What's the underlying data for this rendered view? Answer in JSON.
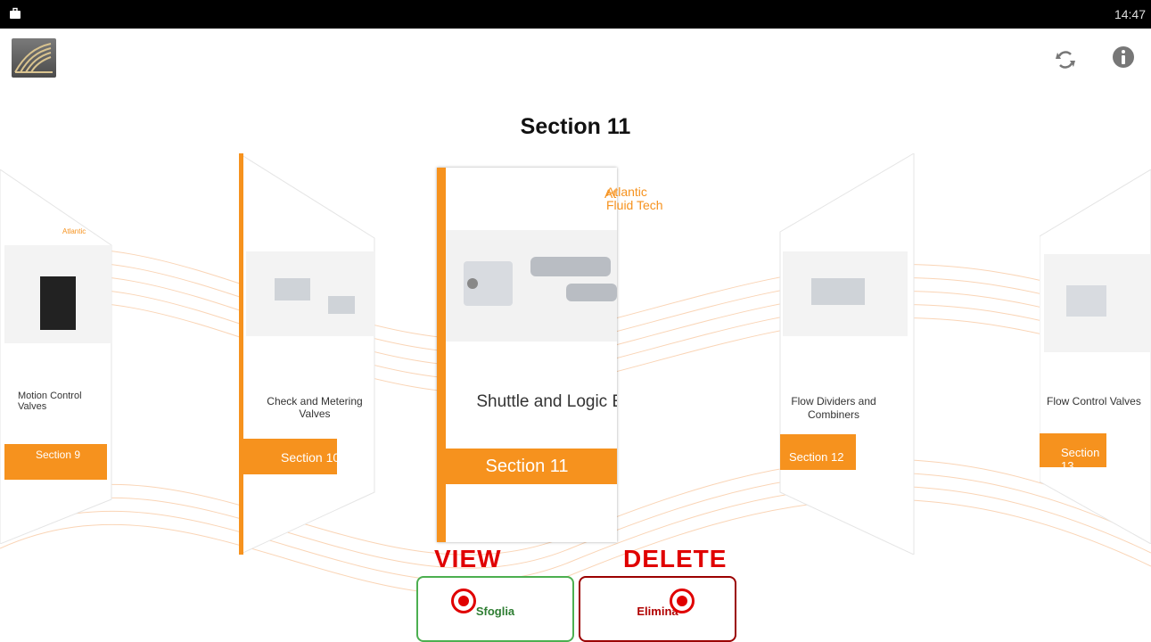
{
  "statusbar": {
    "time": "14:47"
  },
  "header": {
    "title": "Section 11",
    "refresh_icon": "refresh-icon",
    "info_icon": "info-icon"
  },
  "brand": {
    "line1": "Atlantic",
    "line2": "Fluid Tech"
  },
  "cards": [
    {
      "title": "Motion Control Valves",
      "section": "Section 9"
    },
    {
      "title_line1": "Check and Metering",
      "title_line2": "Valves",
      "section": "Section 10"
    },
    {
      "title": "Shuttle and Logic Elements",
      "section": "Section 11"
    },
    {
      "title_line1": "Flow Dividers and",
      "title_line2": "Combiners",
      "section": "Section 12"
    },
    {
      "title": "Flow Control Valves",
      "section": "Section 13"
    }
  ],
  "actions": {
    "view_label": "Sfoglia",
    "delete_label": "Elimina",
    "view_annotation": "VIEW",
    "delete_annotation": "DELETE"
  },
  "colors": {
    "accent": "#f6921e",
    "view": "#4caf50",
    "delete": "#9b0000",
    "marker": "#e00000"
  }
}
